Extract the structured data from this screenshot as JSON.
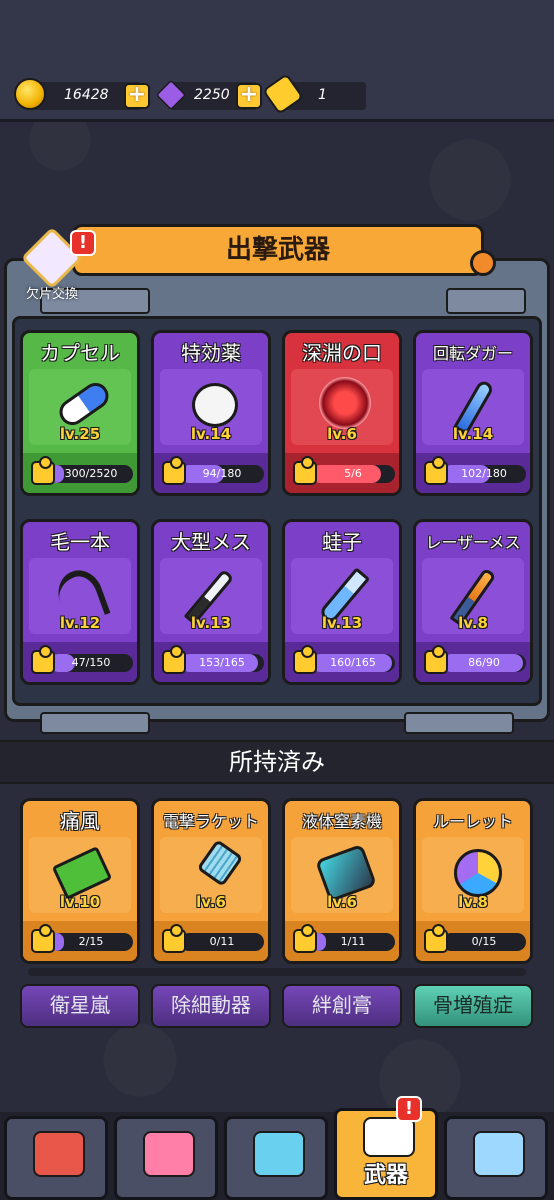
{
  "resources": {
    "coins": "16428",
    "gems": "2250",
    "tickets": "1",
    "plus": "+"
  },
  "equipped": {
    "title": "出撃武器",
    "exchange_label": "欠片交換",
    "alert": "!",
    "cards": [
      {
        "name": "カプセル",
        "level": "lv.25",
        "progress": "300/2520",
        "fill": 0.12,
        "color": "green",
        "icon": "capsule-icon"
      },
      {
        "name": "特効薬",
        "level": "lv.14",
        "progress": "94/180",
        "fill": 0.52,
        "color": "purple",
        "icon": "pill-icon"
      },
      {
        "name": "深淵の口",
        "level": "lv.6",
        "progress": "5/6",
        "fill": 0.83,
        "color": "red",
        "icon": "abyss-mouth-icon"
      },
      {
        "name": "回転ダガー",
        "level": "lv.14",
        "progress": "102/180",
        "fill": 0.57,
        "color": "purple",
        "icon": "dagger-icon"
      },
      {
        "name": "毛一本",
        "level": "lv.12",
        "progress": "47/150",
        "fill": 0.31,
        "color": "purple",
        "icon": "hair-icon"
      },
      {
        "name": "大型メス",
        "level": "lv.13",
        "progress": "153/165",
        "fill": 0.93,
        "color": "purple",
        "icon": "scalpel-icon"
      },
      {
        "name": "蛙子",
        "level": "lv.13",
        "progress": "160/165",
        "fill": 0.97,
        "color": "purple",
        "icon": "test-tube-icon"
      },
      {
        "name": "レーザーメス",
        "level": "lv.8",
        "progress": "86/90",
        "fill": 0.96,
        "color": "purple",
        "icon": "laser-scalpel-icon"
      }
    ]
  },
  "owned": {
    "title": "所持済み",
    "cards": [
      {
        "name": "痛風",
        "level": "lv.10",
        "progress": "2/15",
        "fill": 0.13,
        "color": "orange",
        "icon": "gout-card-icon"
      },
      {
        "name": "電撃ラケット",
        "level": "lv.6",
        "progress": "0/11",
        "fill": 0.0,
        "color": "orange",
        "icon": "racket-icon"
      },
      {
        "name": "液体窒素機",
        "level": "lv.6",
        "progress": "1/11",
        "fill": 0.09,
        "color": "orange",
        "icon": "nitrogen-machine-icon"
      },
      {
        "name": "ルーレット",
        "level": "lv.8",
        "progress": "0/15",
        "fill": 0.0,
        "color": "orange",
        "icon": "roulette-icon"
      }
    ],
    "tabs": [
      {
        "label": "衛星嵐",
        "color": "purple"
      },
      {
        "label": "除細動器",
        "color": "purple"
      },
      {
        "label": "絆創膏",
        "color": "purple"
      },
      {
        "label": "骨増殖症",
        "color": "teal"
      }
    ]
  },
  "nav": {
    "items": [
      {
        "icon": "shop-icon"
      },
      {
        "icon": "nurse-icon"
      },
      {
        "icon": "syringe-icon"
      },
      {
        "icon": "medkit-icon",
        "label": "武器",
        "alert": "!"
      },
      {
        "icon": "rank-icon"
      }
    ]
  }
}
